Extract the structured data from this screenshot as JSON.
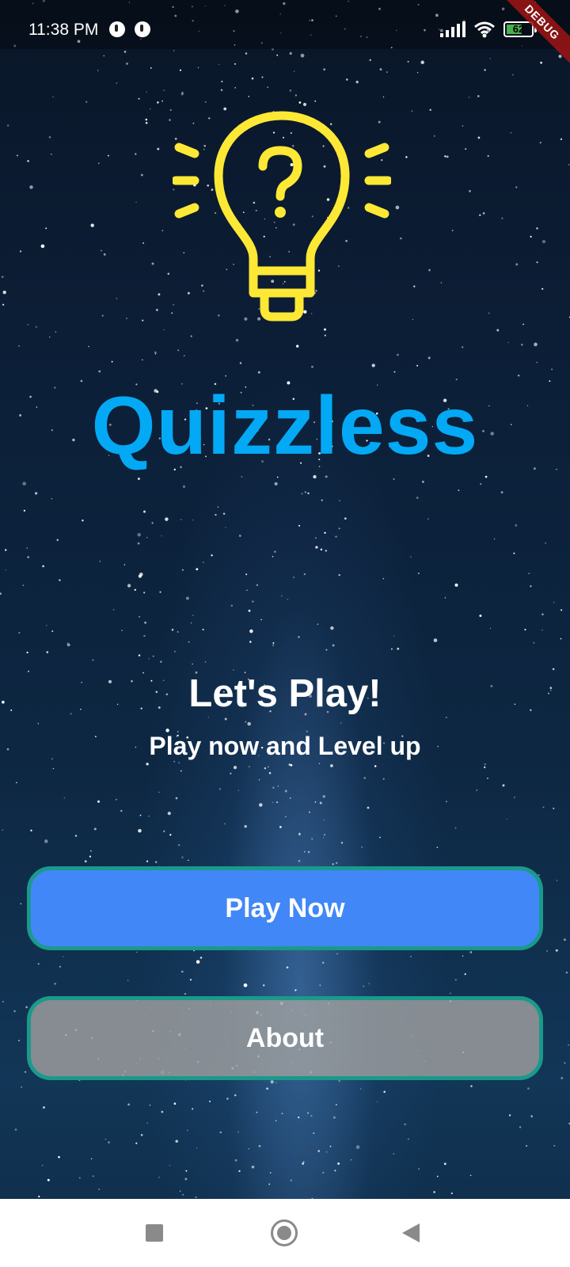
{
  "status_bar": {
    "time": "11:38 PM",
    "battery_level": "62",
    "debug_banner": "DEBUG"
  },
  "app": {
    "title": "Quizzless",
    "headline": "Let's Play!",
    "subheadline": "Play now and Level up"
  },
  "buttons": {
    "play_label": "Play Now",
    "about_label": "About"
  },
  "icons": {
    "logo": "lightbulb-question-icon",
    "nav_recents": "square-icon",
    "nav_home": "circle-icon",
    "nav_back": "back-triangle-icon"
  },
  "colors": {
    "title": "#03a9f4",
    "logo": "#fde835",
    "play_button": "#4187f7",
    "about_button": "#a0a0a0",
    "button_border": "#1a9a8a"
  }
}
